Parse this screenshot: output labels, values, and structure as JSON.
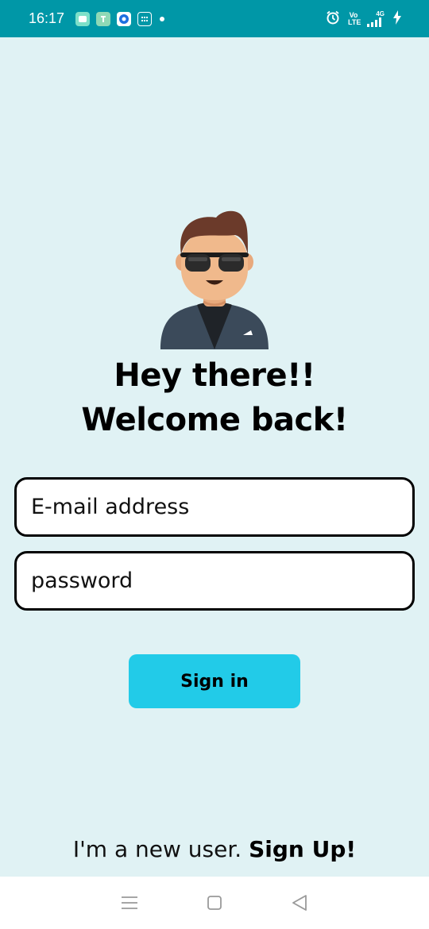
{
  "status_bar": {
    "time": "16:17",
    "network_top": "4G",
    "volte": "Vo LTE",
    "colors": {
      "background": "#0097a7"
    },
    "icons": [
      "messages-icon",
      "app-icon",
      "circle-app-icon",
      "calendar-icon",
      "notification-dot",
      "alarm-icon",
      "volte-icon",
      "signal-icon",
      "charging-icon"
    ]
  },
  "welcome": {
    "headline": "Hey there!! Welcome back!"
  },
  "form": {
    "email_placeholder": "E-mail address",
    "password_placeholder": "password",
    "signin_label": "Sign in"
  },
  "signup": {
    "prefix": "I'm a new user.",
    "link": "Sign Up!"
  },
  "nav": {
    "icons": [
      "menu-icon",
      "home-square-icon",
      "back-triangle-icon"
    ]
  },
  "colors": {
    "page_background": "#e0f2f4",
    "button": "#22cbe8"
  }
}
